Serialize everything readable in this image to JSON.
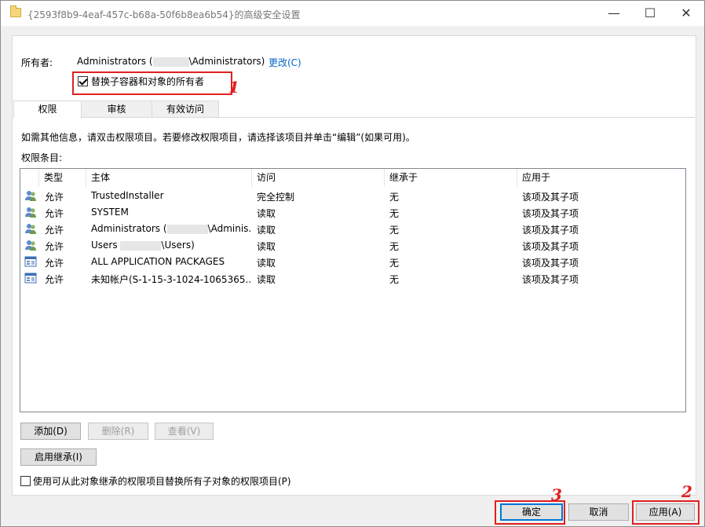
{
  "window": {
    "title": "{2593f8b9-4eaf-457c-b68a-50f6b8ea6b54}的高级安全设置",
    "controls": {
      "minimize": "—",
      "maximize": "☐",
      "close": "✕"
    }
  },
  "owner": {
    "label": "所有者:",
    "value_prefix": "Administrators (",
    "value_suffix": "\\Administrators)",
    "change_link": "更改(C)"
  },
  "replace_owner_checkbox": {
    "label": "替换子容器和对象的所有者",
    "checked": true
  },
  "tabs": [
    {
      "label": "权限",
      "active": true
    },
    {
      "label": "审核",
      "active": false
    },
    {
      "label": "有效访问",
      "active": false
    }
  ],
  "info_text": "如需其他信息，请双击权限项目。若要修改权限项目，请选择该项目并单击“编辑”(如果可用)。",
  "entries_label": "权限条目:",
  "columns": [
    "类型",
    "主体",
    "访问",
    "继承于",
    "应用于"
  ],
  "entries": [
    {
      "icon": "user-group-icon",
      "type": "允许",
      "principal": "TrustedInstaller",
      "access": "完全控制",
      "inherited": "无",
      "applies": "该项及其子项"
    },
    {
      "icon": "user-group-icon",
      "type": "允许",
      "principal": "SYSTEM",
      "access": "读取",
      "inherited": "无",
      "applies": "该项及其子项"
    },
    {
      "icon": "user-group-icon",
      "type": "允许",
      "principal_prefix": "Administrators (",
      "principal_suffix": "\\Adminis...",
      "access": "读取",
      "inherited": "无",
      "applies": "该项及其子项"
    },
    {
      "icon": "user-group-icon",
      "type": "允许",
      "principal_prefix": "Users ",
      "principal_suffix": "\\Users)",
      "access": "读取",
      "inherited": "无",
      "applies": "该项及其子项"
    },
    {
      "icon": "app-package-icon",
      "type": "允许",
      "principal": "ALL APPLICATION PACKAGES",
      "access": "读取",
      "inherited": "无",
      "applies": "该项及其子项"
    },
    {
      "icon": "app-package-icon",
      "type": "允许",
      "principal": "未知帐户(S-1-15-3-1024-1065365...",
      "access": "读取",
      "inherited": "无",
      "applies": "该项及其子项"
    }
  ],
  "buttons": {
    "add": "添加(D)",
    "remove": "删除(R)",
    "view": "查看(V)",
    "enable_inheritance": "启用继承(I)",
    "ok": "确定",
    "cancel": "取消",
    "apply": "应用(A)"
  },
  "replace_child_checkbox": {
    "label": "使用可从此对象继承的权限项目替换所有子对象的权限项目(P)",
    "checked": false
  },
  "annotations": [
    "1",
    "2",
    "3"
  ],
  "colors": {
    "annotation_red": "#e02020",
    "link_blue": "#0066cc",
    "focus_blue": "#0078d7"
  }
}
